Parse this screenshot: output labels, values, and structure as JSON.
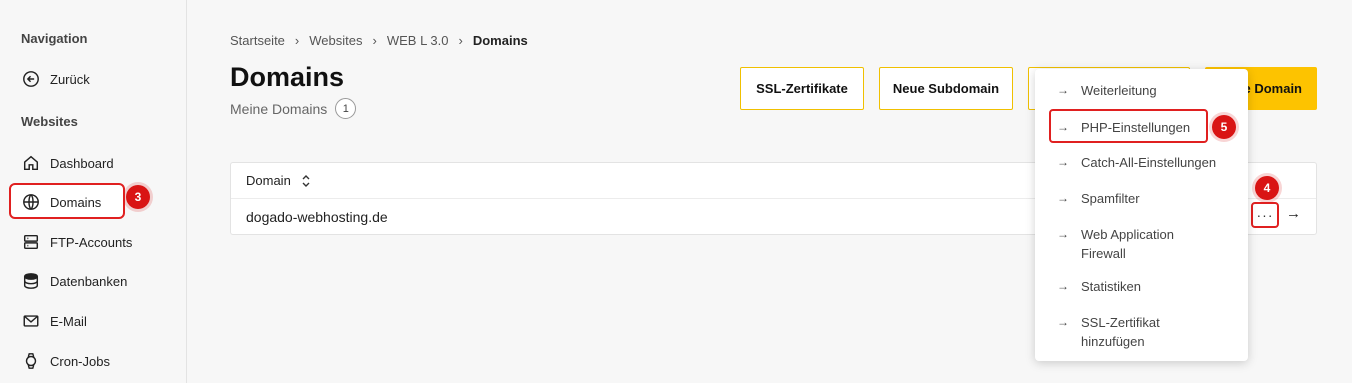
{
  "sidebar": {
    "nav_heading": "Navigation",
    "back_label": "Zurück",
    "websites_heading": "Websites",
    "items": [
      {
        "label": "Dashboard",
        "icon": "home-icon"
      },
      {
        "label": "Domains",
        "icon": "globe-icon"
      },
      {
        "label": "FTP-Accounts",
        "icon": "server-icon"
      },
      {
        "label": "Datenbanken",
        "icon": "database-icon"
      },
      {
        "label": "E-Mail",
        "icon": "mail-icon"
      },
      {
        "label": "Cron-Jobs",
        "icon": "watch-icon"
      }
    ]
  },
  "breadcrumb": [
    "Startseite",
    "Websites",
    "WEB L 3.0",
    "Domains"
  ],
  "page": {
    "title": "Domains",
    "subtitle": "Meine Domains",
    "count": "1"
  },
  "toolbar": {
    "ssl_label": "SSL-Zertifikate",
    "subdomain_label": "Neue Subdomain",
    "new_domain_label": "e Domain"
  },
  "table": {
    "header": "Domain",
    "rows": [
      {
        "domain": "dogado-webhosting.de"
      }
    ],
    "dots": "···",
    "arrow": "→"
  },
  "menu": {
    "items": [
      {
        "label": "Weiterleitung"
      },
      {
        "label": "PHP-Einstellungen"
      },
      {
        "label": "Catch-All-Einstellungen"
      },
      {
        "label": "Spamfilter"
      },
      {
        "label": "Web Application",
        "label2": "Firewall"
      },
      {
        "label": "Statistiken"
      },
      {
        "label": "SSL-Zertifikat",
        "label2": "hinzufügen"
      }
    ]
  },
  "annotations": {
    "step3": "3",
    "step4": "4",
    "step5": "5",
    "color": "#d91414"
  }
}
